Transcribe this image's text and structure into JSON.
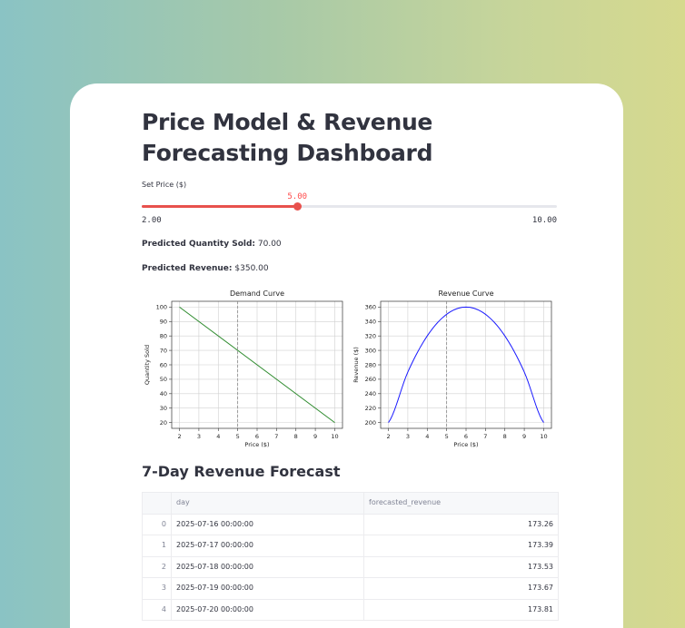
{
  "page": {
    "title": "Price Model & Revenue Forecasting Dashboard"
  },
  "slider": {
    "label": "Set Price ($)",
    "value": 5.0,
    "value_text": "5.00",
    "min": 2.0,
    "max": 10.0,
    "min_text": "2.00",
    "max_text": "10.00",
    "accent_color": "#ff4b4b"
  },
  "metrics": {
    "quantity_label": "Predicted Quantity Sold:",
    "quantity_value": "70.00",
    "revenue_label": "Predicted Revenue:",
    "revenue_value": "$350.00"
  },
  "chart_data": [
    {
      "type": "line",
      "title": "Demand Curve",
      "xlabel": "Price ($)",
      "ylabel": "Quantity Sold",
      "x": [
        2,
        10
      ],
      "series": [
        {
          "values": [
            100,
            20
          ],
          "color": "#2e8b2e"
        }
      ],
      "marker_x": 5,
      "xlim": [
        2,
        10
      ],
      "ylim": [
        20,
        100
      ],
      "xticks": [
        2,
        3,
        4,
        5,
        6,
        7,
        8,
        9,
        10
      ],
      "yticks": [
        20,
        30,
        40,
        50,
        60,
        70,
        80,
        90,
        100
      ],
      "grid": true
    },
    {
      "type": "line",
      "title": "Revenue Curve",
      "xlabel": "Price ($)",
      "ylabel": "Revenue ($)",
      "x": [
        2,
        3,
        4,
        5,
        6,
        7,
        8,
        9,
        10
      ],
      "series": [
        {
          "values": [
            200,
            270,
            320,
            350,
            360,
            350,
            320,
            270,
            200
          ],
          "color": "#1a1aff"
        }
      ],
      "marker_x": 5,
      "xlim": [
        2,
        10
      ],
      "ylim": [
        200,
        360
      ],
      "xticks": [
        2,
        3,
        4,
        5,
        6,
        7,
        8,
        9,
        10
      ],
      "yticks": [
        200,
        220,
        240,
        260,
        280,
        300,
        320,
        340,
        360
      ],
      "grid": true
    }
  ],
  "forecast": {
    "title": "7-Day Revenue Forecast",
    "columns": [
      "",
      "day",
      "forecasted_revenue"
    ],
    "rows": [
      {
        "index": "0",
        "day": "2025-07-16 00:00:00",
        "revenue": "173.26"
      },
      {
        "index": "1",
        "day": "2025-07-17 00:00:00",
        "revenue": "173.39"
      },
      {
        "index": "2",
        "day": "2025-07-18 00:00:00",
        "revenue": "173.53"
      },
      {
        "index": "3",
        "day": "2025-07-19 00:00:00",
        "revenue": "173.67"
      },
      {
        "index": "4",
        "day": "2025-07-20 00:00:00",
        "revenue": "173.81"
      }
    ]
  }
}
